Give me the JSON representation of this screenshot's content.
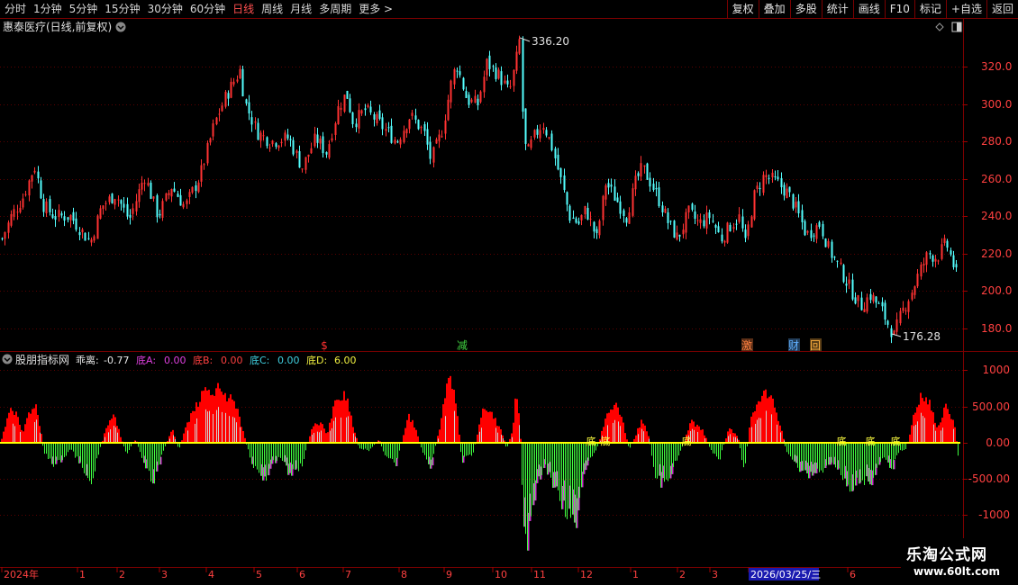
{
  "toolbar": {
    "periods": [
      "分时",
      "1分钟",
      "5分钟",
      "15分钟",
      "30分钟",
      "60分钟",
      "日线",
      "周线",
      "月线",
      "多周期",
      "更多 >"
    ],
    "active_period": "日线",
    "buttons": [
      "复权",
      "叠加",
      "多股",
      "统计",
      "画线",
      "F10",
      "标记",
      "+自选",
      "返回"
    ]
  },
  "main_chart": {
    "title": "惠泰医疗(日线,前复权)",
    "y_ticks": [
      "320.0",
      "300.0",
      "280.0",
      "260.0",
      "240.0",
      "220.0",
      "200.0",
      "180.0"
    ],
    "high_label": "336.20",
    "low_label": "176.28",
    "markers": [
      {
        "text": "$",
        "color": "#ff3030"
      },
      {
        "text": "减",
        "color": "#40d040"
      },
      {
        "text": "激",
        "color": "#ff8040"
      },
      {
        "text": "财",
        "color": "#60b0ff"
      },
      {
        "text": "回",
        "color": "#ffb040"
      }
    ]
  },
  "indicator": {
    "name": "股朋指标网",
    "legend": [
      {
        "label": "乖离:",
        "value": "-0.77",
        "color": "#e8e8e8"
      },
      {
        "label": "底A:",
        "value": "0.00",
        "color": "#e040e0"
      },
      {
        "label": "底B:",
        "value": "0.00",
        "color": "#ff4040"
      },
      {
        "label": "底C:",
        "value": "0.00",
        "color": "#40d0e0"
      },
      {
        "label": "底D:",
        "value": "6.00",
        "color": "#f0f040"
      }
    ],
    "y_ticks": [
      "1000",
      "500.00",
      "0.00",
      "-500.00",
      "-1000"
    ],
    "di_label": "底"
  },
  "x_axis": {
    "labels": [
      "2024年",
      "1",
      "2",
      "3",
      "4",
      "5",
      "6",
      "7",
      "8",
      "9",
      "10",
      "11",
      "12",
      "1",
      "2",
      "3",
      "2026/03/25/三",
      "6"
    ]
  },
  "watermark": {
    "line1": "乐淘公式网",
    "line2": "www.60lt.com"
  },
  "colors": {
    "up": "#ff3232",
    "down": "#54ffff",
    "pos_bar": "#ff0000",
    "neg_bar": "#40ff40",
    "zero_line": "#ffff00",
    "grid": "#7a0000"
  }
}
